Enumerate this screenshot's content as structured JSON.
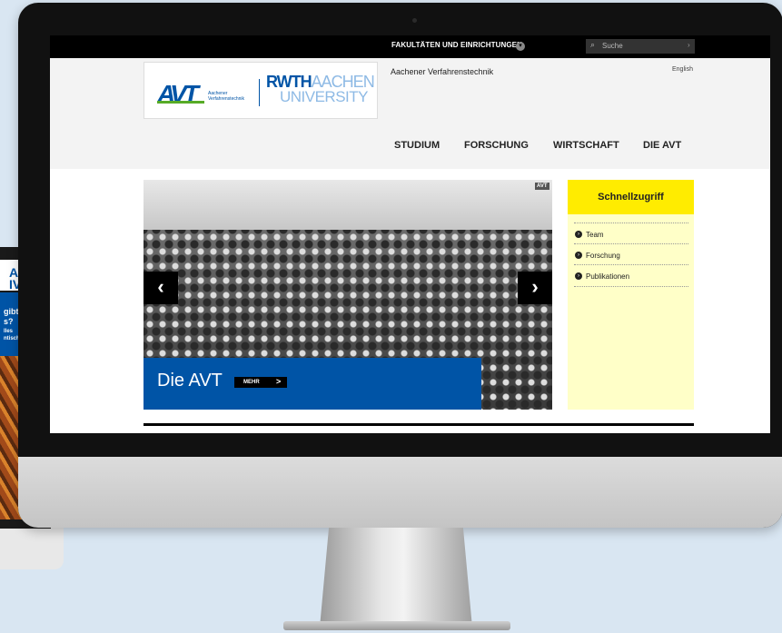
{
  "topbar": {
    "faculties_label": "FAKULTÄTEN UND EINRICHTUNGEN",
    "search_placeholder": "Suche"
  },
  "header": {
    "avt_logo_text": "AVT",
    "avt_subtitle_line1": "Aachener",
    "avt_subtitle_line2": "Verfahrenstechnik",
    "rwth_line1_bold": "RWTH",
    "rwth_line1_light": "AACHEN",
    "rwth_line2": "UNIVERSITY",
    "institute_name": "Aachener Verfahrenstechnik",
    "language_link": "English"
  },
  "nav": {
    "items": [
      "STUDIUM",
      "FORSCHUNG",
      "WIRTSCHAFT",
      "DIE AVT"
    ]
  },
  "hero": {
    "tag": "AVT",
    "title": "Die AVT",
    "more_label": "MEHR",
    "more_arrow": ">",
    "prev_glyph": "‹",
    "next_glyph": "›"
  },
  "quick_access": {
    "title": "Schnellzugriff",
    "items": [
      "Team",
      "Forschung",
      "Publikationen"
    ]
  },
  "background_device": {
    "logo_line1": "AA",
    "logo_line2": "IVE",
    "text_lines": [
      "gibt e",
      "s?",
      "lles",
      "ntische"
    ]
  }
}
